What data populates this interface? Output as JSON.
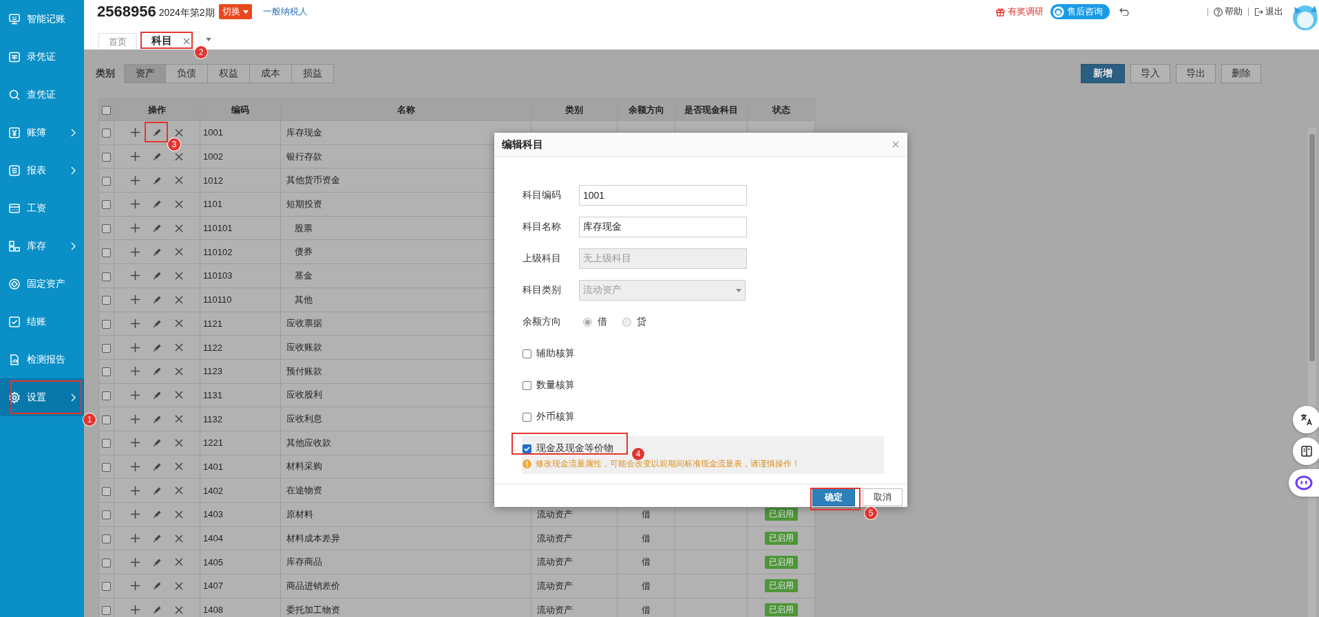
{
  "sidebar": {
    "items": [
      {
        "label": "智能记账",
        "submenu": false,
        "selected": false
      },
      {
        "label": "录凭证",
        "submenu": false,
        "selected": false
      },
      {
        "label": "查凭证",
        "submenu": false,
        "selected": false
      },
      {
        "label": "账簿",
        "submenu": true,
        "selected": false
      },
      {
        "label": "报表",
        "submenu": true,
        "selected": false
      },
      {
        "label": "工资",
        "submenu": false,
        "selected": false
      },
      {
        "label": "库存",
        "submenu": true,
        "selected": false
      },
      {
        "label": "固定资产",
        "submenu": false,
        "selected": false
      },
      {
        "label": "结账",
        "submenu": false,
        "selected": false
      },
      {
        "label": "检测报告",
        "submenu": false,
        "selected": false
      },
      {
        "label": "设置",
        "submenu": true,
        "selected": true
      }
    ]
  },
  "header": {
    "account_code": "2568956",
    "period": "2024年第2期",
    "switch_button": "切换",
    "taxpayer_type": "一般纳税人",
    "tabs": [
      {
        "label": "首页",
        "selected": false,
        "closable": false
      },
      {
        "label": "科目",
        "selected": true,
        "closable": true
      }
    ],
    "links": [
      {
        "kind": "survey",
        "label": "有奖调研"
      },
      {
        "kind": "consult",
        "label": "售后咨询"
      },
      {
        "kind": "undo"
      },
      {
        "kind": "help",
        "label": "帮助"
      },
      {
        "kind": "logout",
        "label": "退出"
      }
    ]
  },
  "category_bar": {
    "label": "类别",
    "tabs": [
      {
        "label": "资产",
        "selected": true
      },
      {
        "label": "负债",
        "selected": false
      },
      {
        "label": "权益",
        "selected": false
      },
      {
        "label": "成本",
        "selected": false
      },
      {
        "label": "损益",
        "selected": false
      }
    ],
    "buttons": [
      {
        "label": "新增",
        "kind": "primary"
      },
      {
        "label": "导入",
        "kind": "default"
      },
      {
        "label": "导出",
        "kind": "default"
      },
      {
        "label": "删除",
        "kind": "default"
      }
    ]
  },
  "table": {
    "header_checked": false,
    "columns": [
      "操作",
      "编码",
      "名称",
      "类别",
      "余额方向",
      "是否现金科目",
      "状态"
    ],
    "rows": [
      {
        "code": "1001",
        "name": "库存现金",
        "checked": false
      },
      {
        "code": "1002",
        "name": "银行存款",
        "checked": false
      },
      {
        "code": "1012",
        "name": "其他货币资金",
        "checked": false
      },
      {
        "code": "1101",
        "name": "短期投资",
        "checked": false,
        "children": [
          {
            "code": "110101",
            "name": "股票",
            "checked": false
          },
          {
            "code": "110102",
            "name": "债券",
            "checked": false
          },
          {
            "code": "110103",
            "name": "基金",
            "checked": false
          },
          {
            "code": "110110",
            "name": "其他",
            "checked": false
          }
        ]
      },
      {
        "code": "1121",
        "name": "应收票据",
        "checked": false
      },
      {
        "code": "1122",
        "name": "应收账款",
        "checked": false
      },
      {
        "code": "1123",
        "name": "预付账款",
        "checked": false
      },
      {
        "code": "1131",
        "name": "应收股利",
        "checked": false
      },
      {
        "code": "1132",
        "name": "应收利息",
        "checked": false
      },
      {
        "code": "1221",
        "name": "其他应收款",
        "checked": false
      },
      {
        "code": "1401",
        "name": "材料采购",
        "checked": false
      },
      {
        "code": "1402",
        "name": "在途物资",
        "checked": false
      },
      {
        "code": "1403",
        "name": "原材料",
        "checked": false,
        "category": "流动资产",
        "direction": "借",
        "status": "已启用"
      },
      {
        "code": "1404",
        "name": "材料成本差异",
        "checked": false,
        "category": "流动资产",
        "direction": "借",
        "status": "已启用"
      },
      {
        "code": "1405",
        "name": "库存商品",
        "checked": false,
        "category": "流动资产",
        "direction": "借",
        "status": "已启用"
      },
      {
        "code": "1407",
        "name": "商品进销差价",
        "checked": false,
        "category": "流动资产",
        "direction": "借",
        "status": "已启用"
      },
      {
        "code": "1408",
        "name": "委托加工物资",
        "checked": false,
        "category": "流动资产",
        "direction": "借",
        "status": "已启用"
      }
    ]
  },
  "dialog": {
    "title": "编辑科目",
    "fields": [
      {
        "label": "科目编码",
        "kind": "text",
        "value": "1001",
        "disabled": false
      },
      {
        "label": "科目名称",
        "kind": "text",
        "value": "库存现金",
        "disabled": false
      },
      {
        "label": "上级科目",
        "kind": "text",
        "value": "无上级科目",
        "disabled": true
      },
      {
        "label": "科目类别",
        "kind": "select",
        "value": "流动资产",
        "disabled": true
      },
      {
        "label": "余额方向",
        "kind": "radio",
        "disabled": true,
        "options": [
          {
            "label": "借",
            "selected": true
          },
          {
            "label": "贷",
            "selected": false
          }
        ]
      }
    ],
    "checkboxes": [
      {
        "label": "辅助核算",
        "checked": false
      },
      {
        "label": "数量核算",
        "checked": false
      },
      {
        "label": "外币核算",
        "checked": false
      },
      {
        "label": "现金及现金等价物",
        "checked": true,
        "warning": "修改现金流量属性，可能会改变以前期间标准现金流量表，请谨慎操作！"
      }
    ],
    "buttons": [
      {
        "label": "确定",
        "kind": "primary"
      },
      {
        "label": "取消",
        "kind": "default"
      }
    ]
  },
  "annotations": [
    {
      "label": "1"
    },
    {
      "label": "2"
    },
    {
      "label": "3"
    },
    {
      "label": "4"
    },
    {
      "label": "5"
    }
  ]
}
